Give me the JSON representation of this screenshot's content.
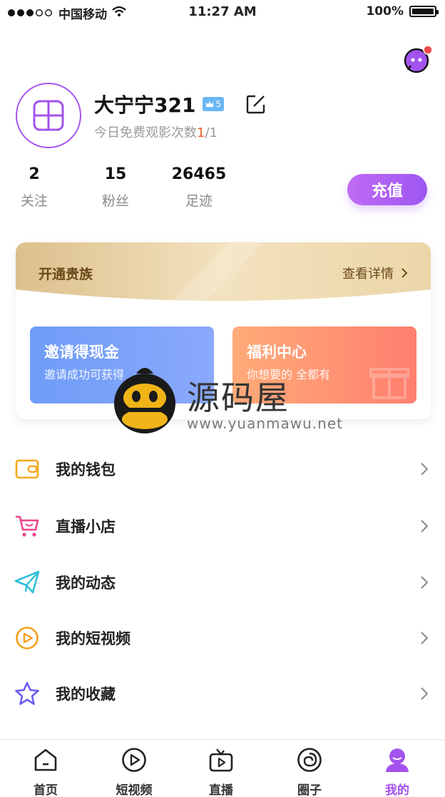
{
  "status_bar": {
    "carrier": "中国移动",
    "time": "11:27 AM",
    "battery": "100%"
  },
  "profile": {
    "username": "大宁宁321",
    "vip_level": "5",
    "free_views_label": "今日免费观影次数",
    "free_views_used": "1",
    "free_views_total": "/1"
  },
  "stats": [
    {
      "value": "2",
      "label": "关注"
    },
    {
      "value": "15",
      "label": "粉丝"
    },
    {
      "value": "26465",
      "label": "足迹"
    }
  ],
  "recharge_label": "充值",
  "vip_card": {
    "title": "开通贵族",
    "detail": "查看详情"
  },
  "promos": {
    "invite": {
      "title": "邀请得现金",
      "subtitle": "邀请成功可获得"
    },
    "welfare": {
      "title": "福利中心",
      "subtitle": "你想要的 全都有"
    }
  },
  "watermark": {
    "brand": "源码屋",
    "url": "www.yuanmawu.net"
  },
  "menu": [
    {
      "label": "我的钱包",
      "icon": "wallet-icon"
    },
    {
      "label": "直播小店",
      "icon": "cart-icon"
    },
    {
      "label": "我的动态",
      "icon": "paper-plane-icon"
    },
    {
      "label": "我的短视频",
      "icon": "play-circle-icon"
    },
    {
      "label": "我的收藏",
      "icon": "star-icon"
    }
  ],
  "tabs": [
    {
      "label": "首页",
      "icon": "home-icon"
    },
    {
      "label": "短视频",
      "icon": "video-play-icon"
    },
    {
      "label": "直播",
      "icon": "tv-icon"
    },
    {
      "label": "圈子",
      "icon": "circle-icon"
    },
    {
      "label": "我的",
      "icon": "user-icon",
      "active": true
    }
  ],
  "colors": {
    "accent": "#a452ee",
    "gold_text": "#6b4a1a",
    "highlight": "#f35b2b"
  }
}
